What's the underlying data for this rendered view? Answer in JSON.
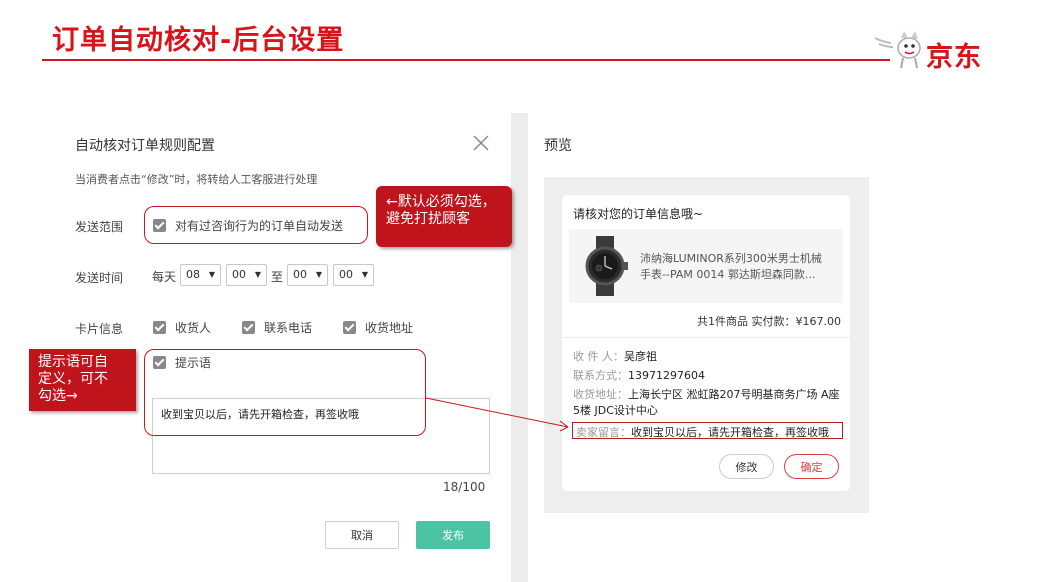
{
  "header": {
    "title": "订单自动核对-后台设置",
    "logo_text": "京东"
  },
  "dialog": {
    "title": "自动核对订单规则配置",
    "description": "当消费者点击“修改”时，将转给人工客服进行处理",
    "send_scope": {
      "label": "发送范围",
      "option": "对有过咨询行为的订单自动发送",
      "checked": true
    },
    "send_time": {
      "label": "发送时间",
      "daily": "每天",
      "to": "至",
      "start_hour": "08",
      "start_minute": "00",
      "end_hour": "00",
      "end_minute": "00"
    },
    "card_info": {
      "label": "卡片信息",
      "options": [
        {
          "label": "收货人",
          "checked": true
        },
        {
          "label": "联系电话",
          "checked": true
        },
        {
          "label": "收货地址",
          "checked": true
        }
      ]
    },
    "tip": {
      "label": "提示语",
      "checked": true,
      "text": "收到宝贝以后，请先开箱检查，再签收哦",
      "counter": "18/100"
    },
    "cancel_label": "取消",
    "publish_label": "发布"
  },
  "preview": {
    "title": "预览",
    "heading": "请核对您的订单信息哦~",
    "product_name_line1": "沛纳海LUMINOR系列300米男士机械",
    "product_name_line2": "手表--PAM 0014 郭达斯坦森同款...",
    "summary": "共1件商品  实付款：¥167.00",
    "receiver_label": "收 件 人：",
    "receiver": "吴彦祖",
    "phone_label": "联系方式：",
    "phone": "13971297604",
    "address_label": "收货地址：",
    "address_line1": "上海长宁区 淞虹路207号明基商务广场 A座",
    "address_line2": "5楼 JDC设计中心",
    "note_label": "卖家留言：",
    "note": "收到宝贝以后，请先开箱检查，再签收哦",
    "modify_label": "修改",
    "confirm_label": "确定"
  },
  "annotations": {
    "callout_1_line1": "←默认必须勾选，",
    "callout_1_line2": "避免打扰顾客",
    "callout_2_line1": "提示语可自",
    "callout_2_line2": "定义，可不",
    "callout_2_line3": "勾选→"
  },
  "colors": {
    "brand_red": "#d8131a",
    "publish_green": "#4cc3a2",
    "checkbox_gray": "#888888"
  },
  "icons": [
    "close-icon",
    "jd-dog-logo-icon",
    "checkbox-checked-icon",
    "chevron-down-icon",
    "watch-image"
  ]
}
